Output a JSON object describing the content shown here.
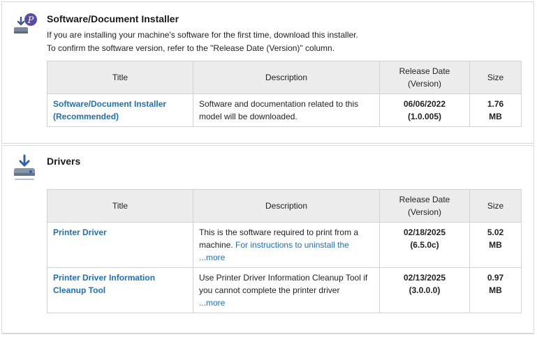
{
  "installer": {
    "title": "Software/Document Installer",
    "intro_line1": "If you are installing your machine's software for the first time, download this installer.",
    "intro_line2": "To confirm the software version, refer to the \"Release Date (Version)\" column.",
    "icon": "installer-download-icon",
    "columns": {
      "title": "Title",
      "description": "Description",
      "release_line1": "Release Date",
      "release_line2": "(Version)",
      "size": "Size"
    },
    "rows": [
      {
        "title_line1": "Software/Document Installer",
        "title_line2": "(Recommended)",
        "description": "Software and documentation related to this model will be downloaded.",
        "date": "06/06/2022",
        "version": "(1.0.005)",
        "size_value": "1.76",
        "size_unit": "MB"
      }
    ]
  },
  "drivers": {
    "title": "Drivers",
    "icon": "driver-download-icon",
    "columns": {
      "title": "Title",
      "description": "Description",
      "release_line1": "Release Date",
      "release_line2": "(Version)",
      "size": "Size"
    },
    "rows": [
      {
        "title": "Printer Driver",
        "desc_text": "This is the software required to print from a machine.",
        "desc_link": "For instructions to uninstall the",
        "more": "...more",
        "date": "02/18/2025",
        "version": "(6.5.0c)",
        "size_value": "5.02",
        "size_unit": "MB"
      },
      {
        "title": "Printer Driver Information Cleanup Tool",
        "desc_text": "Use Printer Driver Information Cleanup Tool if you cannot complete the printer driver",
        "more": "...more",
        "date": "02/13/2025",
        "version": "(3.0.0.0)",
        "size_value": "0.97",
        "size_unit": "MB"
      }
    ]
  },
  "colors": {
    "link": "#1f6fb5",
    "header_bg": "#ececec",
    "border": "#d2d2d2"
  }
}
